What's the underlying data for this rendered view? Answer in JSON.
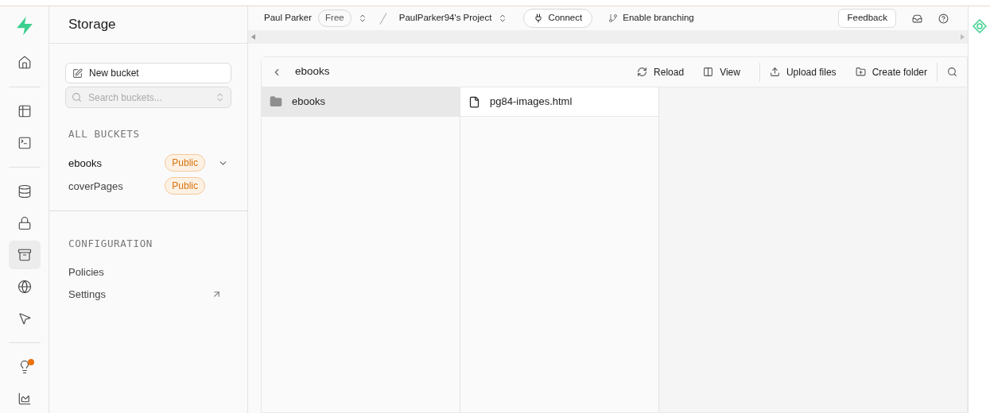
{
  "nav_rail": [
    {
      "selected": false
    },
    {
      "selected": false
    },
    {
      "selected": false
    },
    {
      "selected": false
    },
    {
      "selected": false
    },
    {
      "selected": true
    },
    {
      "selected": false
    },
    {
      "selected": false
    },
    {
      "selected": false,
      "notification": true
    },
    {
      "selected": false
    }
  ],
  "sidebar": {
    "title": "Storage",
    "new_button": "New bucket",
    "search": {
      "placeholder": "Search buckets..."
    },
    "buckets_heading": "ALL BUCKETS",
    "buckets": [
      {
        "name": "ebooks",
        "badge": "Public",
        "selected": true,
        "expanded": false
      },
      {
        "name": "coverPages",
        "badge": "Public",
        "selected": false
      }
    ],
    "config_heading": "CONFIGURATION",
    "config_items": [
      {
        "label": "Policies",
        "external": false
      },
      {
        "label": "Settings",
        "external": true
      }
    ]
  },
  "topbar": {
    "org": "Paul Parker",
    "plan": "Free",
    "project": "PaulParker94's Project",
    "connect": "Connect",
    "branching": "Enable branching",
    "feedback": "Feedback"
  },
  "explorer": {
    "path": "ebooks",
    "actions": [
      {
        "label": "Reload"
      },
      {
        "label": "View"
      },
      {
        "label": "Upload files"
      },
      {
        "label": "Create folder"
      }
    ],
    "columns": [
      [
        {
          "name": "ebooks",
          "kind": "folder",
          "selected": true
        }
      ],
      [
        {
          "name": "pg84-images.html",
          "kind": "file",
          "selected": false
        }
      ]
    ]
  }
}
